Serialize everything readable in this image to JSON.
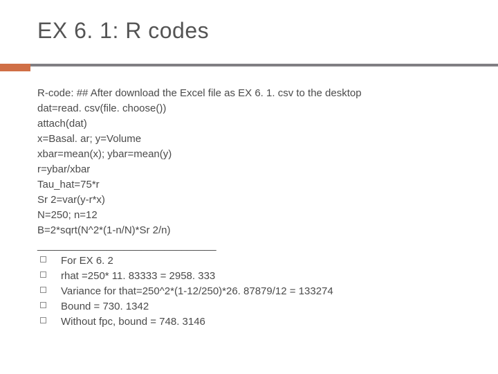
{
  "title": "EX 6. 1: R codes",
  "code_lines": [
    "R-code: ## After download the Excel file as EX 6. 1. csv to the desktop",
    "dat=read. csv(file. choose())",
    "attach(dat)",
    "x=Basal. ar; y=Volume",
    "xbar=mean(x); ybar=mean(y)",
    "r=ybar/xbar",
    "Tau_hat=75*r",
    "Sr 2=var(y-r*x)",
    "N=250; n=12",
    "B=2*sqrt(N^2*(1-n/N)*Sr 2/n)",
    "_______________________________"
  ],
  "bullets": [
    "For EX 6. 2",
    "rhat =250* 11. 83333 = 2958. 333",
    "Variance for that=250^2*(1-12/250)*26. 87879/12 = 133274",
    "Bound = 730. 1342",
    "Without fpc, bound = 748. 3146"
  ]
}
